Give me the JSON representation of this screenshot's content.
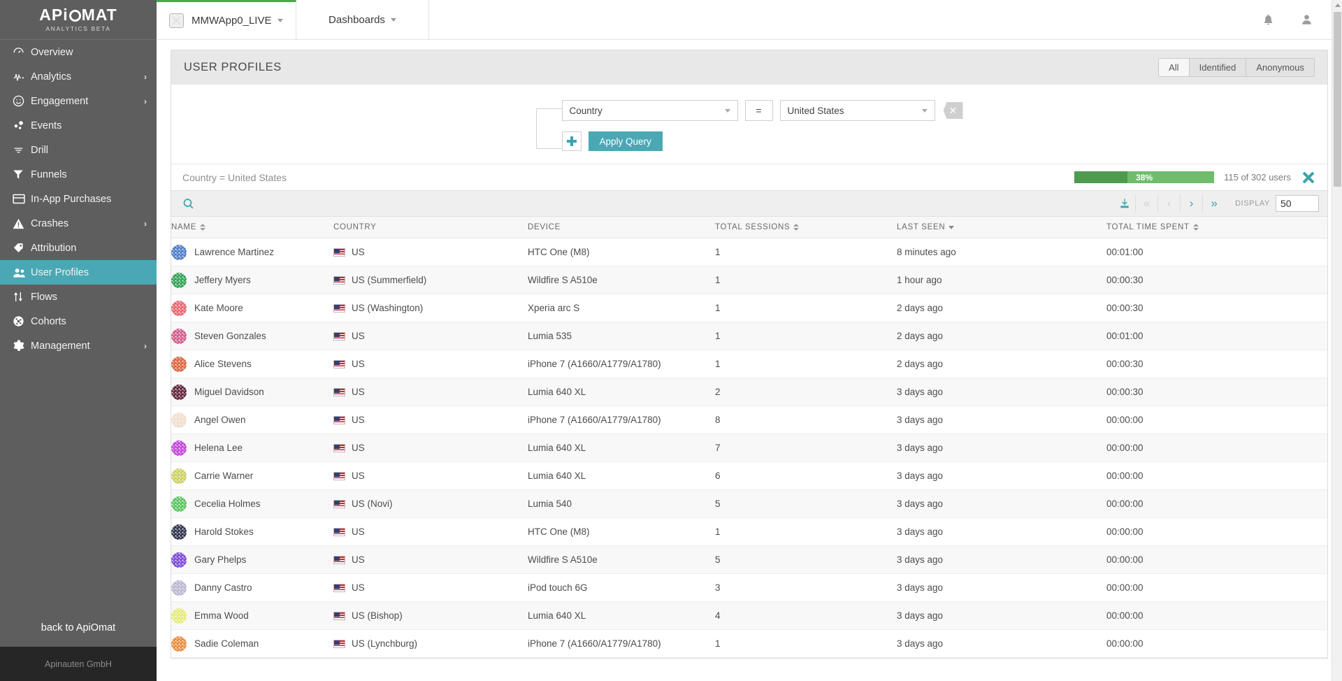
{
  "brand": {
    "name": "ApiOmat",
    "logo_text": "APiOMAT",
    "subtitle": "ANALYTICS BETA"
  },
  "sidebar": {
    "items": [
      {
        "label": "Overview",
        "icon": "gauge-icon",
        "has_chevron": false,
        "active": false
      },
      {
        "label": "Analytics",
        "icon": "pulse-icon",
        "has_chevron": true,
        "active": false
      },
      {
        "label": "Engagement",
        "icon": "smiley-icon",
        "has_chevron": true,
        "active": false
      },
      {
        "label": "Events",
        "icon": "dots-icon",
        "has_chevron": false,
        "active": false
      },
      {
        "label": "Drill",
        "icon": "filter-lines-icon",
        "has_chevron": false,
        "active": false
      },
      {
        "label": "Funnels",
        "icon": "funnel-icon",
        "has_chevron": false,
        "active": false
      },
      {
        "label": "In-App Purchases",
        "icon": "card-icon",
        "has_chevron": false,
        "active": false
      },
      {
        "label": "Crashes",
        "icon": "warning-icon",
        "has_chevron": true,
        "active": false
      },
      {
        "label": "Attribution",
        "icon": "tag-icon",
        "has_chevron": false,
        "active": false
      },
      {
        "label": "User Profiles",
        "icon": "users-icon",
        "has_chevron": false,
        "active": true
      },
      {
        "label": "Flows",
        "icon": "flows-icon",
        "has_chevron": false,
        "active": false
      },
      {
        "label": "Cohorts",
        "icon": "cohorts-icon",
        "has_chevron": false,
        "active": false
      },
      {
        "label": "Management",
        "icon": "gear-icon",
        "has_chevron": true,
        "active": false
      }
    ],
    "back_link": "back to ApiOmat",
    "footer": "Apinauten GmbH"
  },
  "topbar": {
    "app_tab": "MMWApp0_LIVE",
    "dashboards_tab": "Dashboards",
    "notifications_icon": "bell-icon",
    "account_icon": "user-icon",
    "accent_color": "#3fae49"
  },
  "page": {
    "title": "USER PROFILES",
    "segments": [
      {
        "label": "All",
        "selected": true
      },
      {
        "label": "Identified",
        "selected": false
      },
      {
        "label": "Anonymous",
        "selected": false
      }
    ]
  },
  "query": {
    "field": "Country",
    "operator": "=",
    "value": "United States",
    "add_label": "+",
    "apply_label": "Apply Query",
    "delete_icon": "remove-condition-icon"
  },
  "result": {
    "summary": "Country = United States",
    "progress_percent": "38%",
    "progress_value": 38,
    "users_count": "115 of 302 users",
    "close_icon": "clear-query-icon"
  },
  "toolbar": {
    "search_icon": "search-icon",
    "download_icon": "download-icon",
    "first_page": "«",
    "prev_page": "‹",
    "next_page": "›",
    "last_page": "»",
    "display_label": "DISPLAY",
    "display_value": "50"
  },
  "table": {
    "columns": [
      {
        "label": "NAME",
        "sort": "both"
      },
      {
        "label": "COUNTRY",
        "sort": "none"
      },
      {
        "label": "DEVICE",
        "sort": "none"
      },
      {
        "label": "TOTAL SESSIONS",
        "sort": "both"
      },
      {
        "label": "LAST SEEN",
        "sort": "desc"
      },
      {
        "label": "TOTAL TIME SPENT",
        "sort": "both"
      }
    ],
    "rows": [
      {
        "name": "Lawrence Martinez",
        "avatar_color": "#4a78c8",
        "country": "US",
        "device": "HTC One (M8)",
        "sessions": "1",
        "last_seen": "8 minutes ago",
        "time_spent": "00:01:00"
      },
      {
        "name": "Jeffery Myers",
        "avatar_color": "#2e9e4f",
        "country": "US (Summerfield)",
        "device": "Wildfire S A510e",
        "sessions": "1",
        "last_seen": "1 hour ago",
        "time_spent": "00:00:30"
      },
      {
        "name": "Kate Moore",
        "avatar_color": "#e8616b",
        "country": "US (Washington)",
        "device": "Xperia arc S",
        "sessions": "1",
        "last_seen": "2 days ago",
        "time_spent": "00:00:30"
      },
      {
        "name": "Steven Gonzales",
        "avatar_color": "#cf5a8a",
        "country": "US",
        "device": "Lumia 535",
        "sessions": "1",
        "last_seen": "2 days ago",
        "time_spent": "00:01:00"
      },
      {
        "name": "Alice Stevens",
        "avatar_color": "#d9623a",
        "country": "US",
        "device": "iPhone 7 (A1660/A1779/A1780)",
        "sessions": "1",
        "last_seen": "2 days ago",
        "time_spent": "00:00:30"
      },
      {
        "name": "Miguel Davidson",
        "avatar_color": "#5c1f36",
        "country": "US",
        "device": "Lumia 640 XL",
        "sessions": "2",
        "last_seen": "3 days ago",
        "time_spent": "00:00:30"
      },
      {
        "name": "Angel Owen",
        "avatar_color": "#f0ddc8",
        "country": "US",
        "device": "iPhone 7 (A1660/A1779/A1780)",
        "sessions": "8",
        "last_seen": "3 days ago",
        "time_spent": "00:00:00"
      },
      {
        "name": "Helena Lee",
        "avatar_color": "#c040d8",
        "country": "US",
        "device": "Lumia 640 XL",
        "sessions": "7",
        "last_seen": "3 days ago",
        "time_spent": "00:00:00"
      },
      {
        "name": "Carrie Warner",
        "avatar_color": "#c9cf5e",
        "country": "US",
        "device": "Lumia 640 XL",
        "sessions": "6",
        "last_seen": "3 days ago",
        "time_spent": "00:00:00"
      },
      {
        "name": "Cecelia Holmes",
        "avatar_color": "#55c35a",
        "country": "US (Novi)",
        "device": "Lumia 540",
        "sessions": "5",
        "last_seen": "3 days ago",
        "time_spent": "00:00:00"
      },
      {
        "name": "Harold Stokes",
        "avatar_color": "#2b2f4a",
        "country": "US",
        "device": "HTC One (M8)",
        "sessions": "1",
        "last_seen": "3 days ago",
        "time_spent": "00:00:00"
      },
      {
        "name": "Gary Phelps",
        "avatar_color": "#7a44d8",
        "country": "US",
        "device": "Wildfire S A510e",
        "sessions": "5",
        "last_seen": "3 days ago",
        "time_spent": "00:00:00"
      },
      {
        "name": "Danny Castro",
        "avatar_color": "#b9b4d0",
        "country": "US",
        "device": "iPod touch 6G",
        "sessions": "3",
        "last_seen": "3 days ago",
        "time_spent": "00:00:00"
      },
      {
        "name": "Emma Wood",
        "avatar_color": "#e3ea74",
        "country": "US (Bishop)",
        "device": "Lumia 640 XL",
        "sessions": "4",
        "last_seen": "3 days ago",
        "time_spent": "00:00:00"
      },
      {
        "name": "Sadie Coleman",
        "avatar_color": "#e88a3c",
        "country": "US (Lynchburg)",
        "device": "iPhone 7 (A1660/A1779/A1780)",
        "sessions": "1",
        "last_seen": "3 days ago",
        "time_spent": "00:00:00"
      }
    ]
  },
  "colors": {
    "accent_teal": "#4aa8b4",
    "sidebar_bg": "#5e5e5e",
    "green": "#3fae49"
  }
}
